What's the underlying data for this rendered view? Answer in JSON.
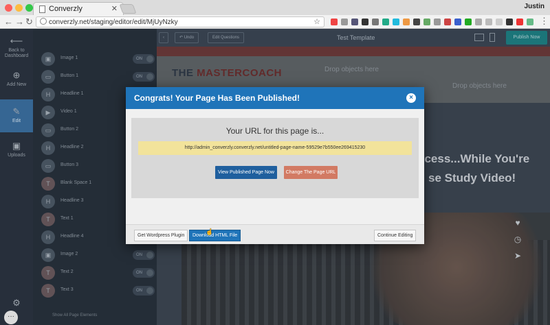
{
  "browser": {
    "tab_title": "Converzly",
    "tab_close": "✕",
    "user_name": "Justin",
    "url": "converzly.net/staging/editor/edit/MjUyNzky"
  },
  "rail": [
    {
      "label": "Back to Dashboard",
      "icon": "arrow-left-icon"
    },
    {
      "label": "Add New",
      "icon": "plus-circle-icon"
    },
    {
      "label": "Edit",
      "icon": "pencil-icon"
    },
    {
      "label": "Uploads",
      "icon": "image-icon"
    }
  ],
  "panel": {
    "items": [
      {
        "label": "Image 1",
        "toggle": "ON"
      },
      {
        "label": "Button 1",
        "toggle": "ON"
      },
      {
        "label": "Headline 1",
        "toggle": ""
      },
      {
        "label": "Video 1",
        "toggle": ""
      },
      {
        "label": "Button 2",
        "toggle": ""
      },
      {
        "label": "Headline 2",
        "toggle": ""
      },
      {
        "label": "Button 3",
        "toggle": ""
      },
      {
        "label": "Blank Space 1",
        "toggle": ""
      },
      {
        "label": "Headline 3",
        "toggle": ""
      },
      {
        "label": "Text 1",
        "toggle": ""
      },
      {
        "label": "Headline 4",
        "toggle": ""
      },
      {
        "label": "Image 2",
        "toggle": "ON"
      },
      {
        "label": "Text 2",
        "toggle": "ON"
      },
      {
        "label": "Text 3",
        "toggle": "ON"
      }
    ],
    "show_all": "Show All Page Elements"
  },
  "editor": {
    "undo_label": "Undo",
    "edit_questions": "Edit Questions",
    "title": "Test Template",
    "publish_label": "Publish Now",
    "logo_prefix": "THE ",
    "logo_brand": "MASTERCOACH",
    "drop_hint": "Drop objects here",
    "drop_hint2": "Drop objects here",
    "hero_line1": "ccess...While You're",
    "hero_line2": "se Study Video!"
  },
  "modal": {
    "title": "Congrats! Your Page Has Been Published!",
    "close": "×",
    "heading": "Your URL for this page is...",
    "url": "http://admin_converzly.converzly.net/untitled-page-name-59529e7b550ee269415230",
    "view_label": "View Published Page Now",
    "change_label": "Change The Page URL",
    "wordpress_label": "Get Wordpress Plugin",
    "download_label": "Download HTML File",
    "continue_label": "Continue Editing"
  },
  "colors": {
    "modal_header": "#1f74b9",
    "url_highlight": "#f2e39b",
    "view_button": "#1f5f9e",
    "change_button": "#d27a63"
  }
}
